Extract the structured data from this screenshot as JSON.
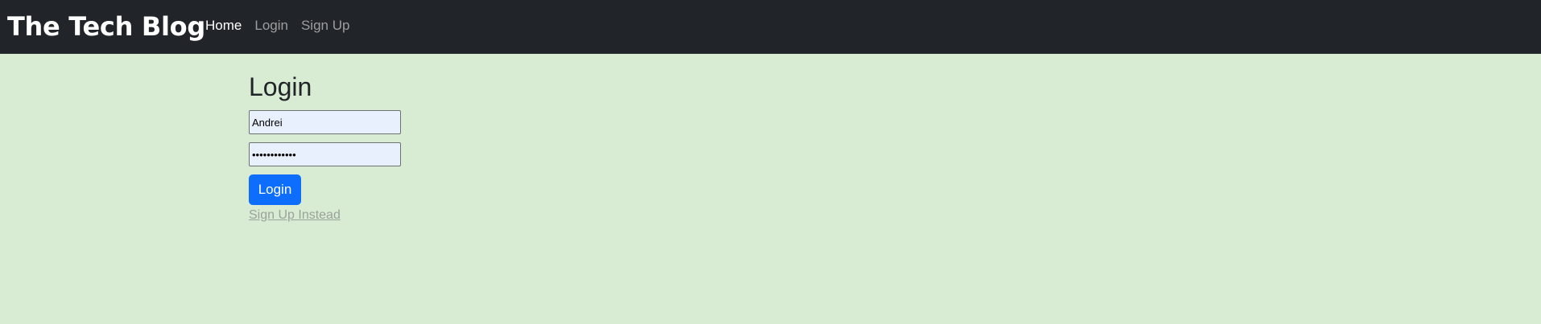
{
  "navbar": {
    "brand": "The Tech Blog",
    "links": [
      {
        "label": "Home",
        "active": true
      },
      {
        "label": "Login",
        "active": false
      },
      {
        "label": "Sign Up",
        "active": false
      }
    ]
  },
  "login_form": {
    "title": "Login",
    "username_value": "Andrei",
    "password_value": "••••••••••••",
    "submit_label": "Login",
    "signup_link": "Sign Up Instead"
  },
  "colors": {
    "navbar_bg": "#212529",
    "page_bg": "#d8ebd3",
    "primary": "#0d6efd",
    "autofill_bg": "#e8f0fe"
  }
}
